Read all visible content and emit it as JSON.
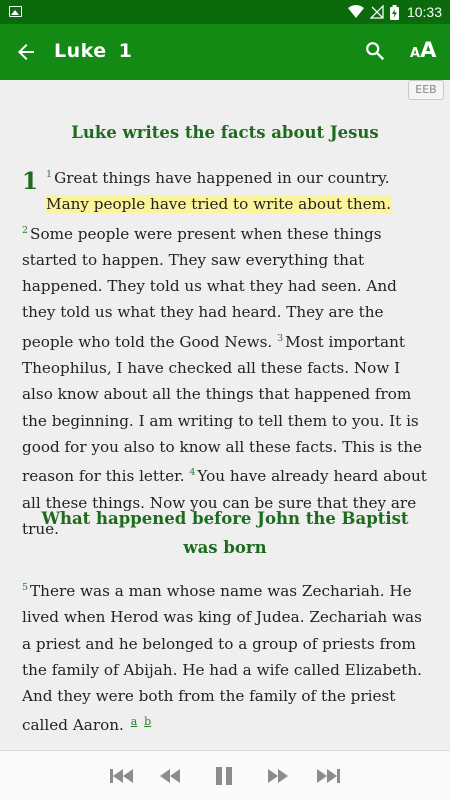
{
  "status_bar": {
    "time": "10:33",
    "icons": [
      "image-icon",
      "wifi-icon",
      "no-signal-icon",
      "battery-charging-icon"
    ]
  },
  "app_bar": {
    "book": "Luke",
    "chapter": "1",
    "font_icon_small": "A",
    "font_icon_big": "A"
  },
  "version_badge": "EEB",
  "sections": [
    {
      "heading": "Luke writes the facts about Jesus"
    },
    {
      "heading": "What happened before John the Baptist was born"
    }
  ],
  "chapter_number": "1",
  "verses": {
    "v1_num": "1",
    "v1_pre": "Great things have happened in our country. ",
    "v1_highlight": "Many people have tried to write about them.",
    "v2_num": "2",
    "v2": "Some people were present when these things started to happen. They saw everything that happened. They told us what they had seen. And they told us what they had heard. They are the people who told the Good News. ",
    "v3_num": "3",
    "v3": "Most important Theophilus, I have checked all these facts. Now I also know about all the things that happened from the beginning. I am writing to tell them to you. It is good for you also to know all these facts. This is the reason for this letter. ",
    "v4_num": "4",
    "v4": "You have already heard about all these things. Now you can be sure that they are true.",
    "v5_num": "5",
    "v5": "There was a man whose name was Zechariah. He lived when Herod was king of Judea. Zechariah was a priest and he belonged to a group of priests from the family of Abijah. He had a wife called Elizabeth. And they were both from the family of the priest called Aaron.",
    "footnote_a": "a",
    "footnote_b": "b"
  },
  "colors": {
    "status_bar": "#0b6a0b",
    "app_bar": "#138a13",
    "heading": "#1d6b1d",
    "highlight": "#fbf49a",
    "background": "#efefef"
  },
  "playback_controls": [
    "skip-previous-icon",
    "rewind-icon",
    "pause-icon",
    "fast-forward-icon",
    "skip-next-icon"
  ]
}
